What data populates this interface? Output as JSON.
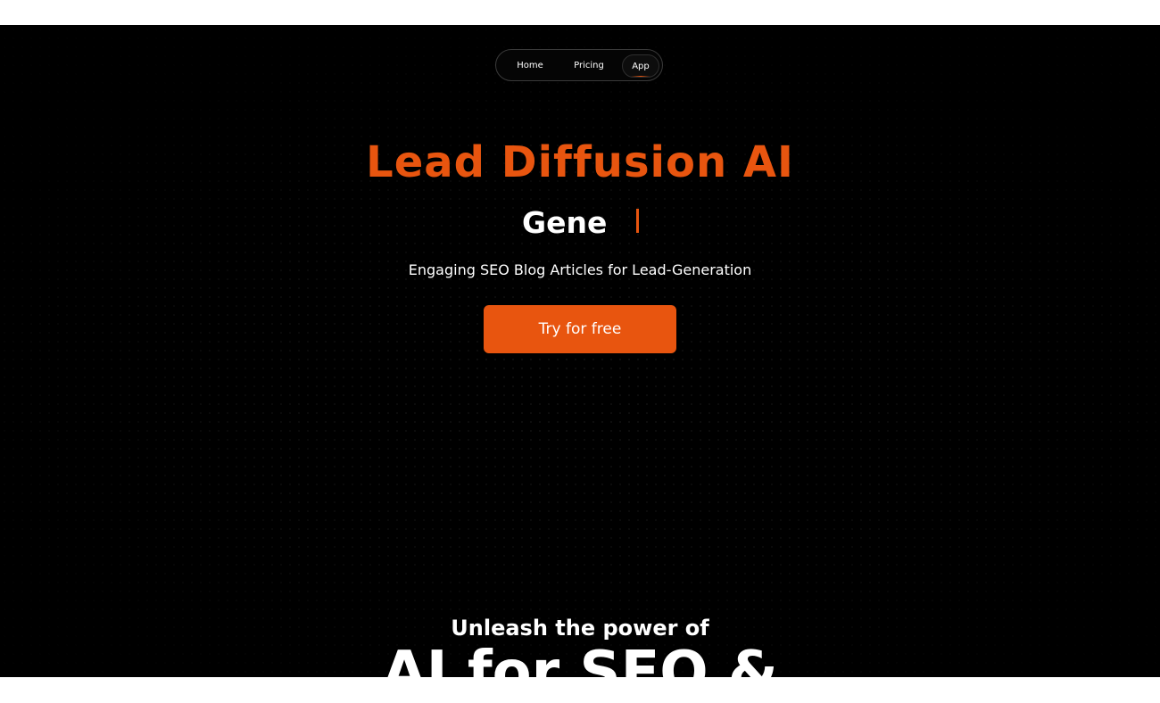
{
  "nav": {
    "items": [
      {
        "label": "Home"
      },
      {
        "label": "Pricing"
      },
      {
        "label": "App"
      }
    ]
  },
  "hero": {
    "title": "Lead Diffusion AI",
    "typing_text": "Gene",
    "tagline": "Engaging SEO Blog Articles for Lead-Generation",
    "cta_label": "Try for free"
  },
  "section": {
    "subtitle": "Unleash the power of",
    "headline": "AI for SEO &"
  },
  "colors": {
    "accent": "#e8550f",
    "background": "#000000",
    "text": "#ffffff"
  }
}
